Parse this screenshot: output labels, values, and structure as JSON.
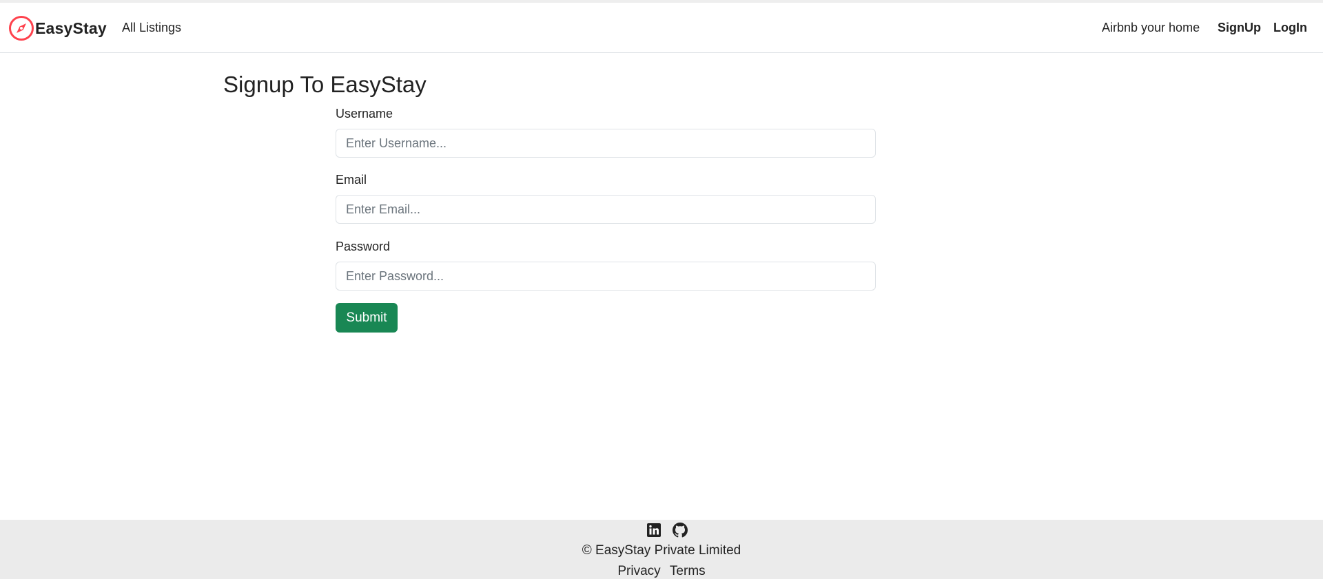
{
  "navbar": {
    "brand": "EasyStay",
    "brand_icon": "compass-icon",
    "brand_color": "#fe424d",
    "all_listings": "All Listings",
    "host": "Airbnb your home",
    "signup": "SignUp",
    "login": "LogIn"
  },
  "main": {
    "title": "Signup To EasyStay",
    "username": {
      "label": "Username",
      "placeholder": "Enter Username...",
      "value": ""
    },
    "email": {
      "label": "Email",
      "placeholder": "Enter Email...",
      "value": ""
    },
    "password": {
      "label": "Password",
      "placeholder": "Enter Password...",
      "value": ""
    },
    "submit": "Submit",
    "submit_color": "#198754"
  },
  "footer": {
    "icons": [
      "linkedin-icon",
      "github-icon"
    ],
    "copyright": "© EasyStay Private Limited",
    "privacy": "Privacy",
    "terms": "Terms"
  }
}
